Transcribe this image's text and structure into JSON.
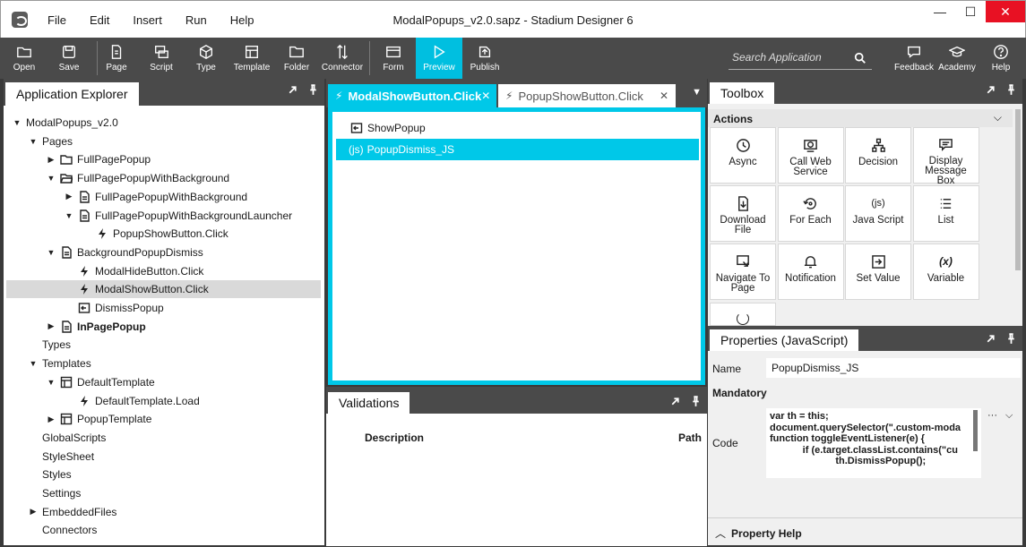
{
  "menu": [
    "File",
    "Edit",
    "Insert",
    "Run",
    "Help"
  ],
  "window_title": "ModalPopups_v2.0.sapz - Stadium Designer 6",
  "window_controls": [
    "—",
    "☐",
    "✕"
  ],
  "toolbar": {
    "items": [
      {
        "label": "Open",
        "icon": "folder-open-icon"
      },
      {
        "label": "Save",
        "icon": "save-icon"
      },
      {
        "label": "Page",
        "icon": "page-icon"
      },
      {
        "label": "Script",
        "icon": "script-icon"
      },
      {
        "label": "Type",
        "icon": "type-icon"
      },
      {
        "label": "Template",
        "icon": "template-icon"
      },
      {
        "label": "Folder",
        "icon": "folder-icon"
      },
      {
        "label": "Connector",
        "icon": "connector-icon"
      },
      {
        "label": "Form",
        "icon": "form-icon"
      },
      {
        "label": "Preview",
        "icon": "preview-icon"
      },
      {
        "label": "Publish",
        "icon": "publish-icon"
      }
    ],
    "search_placeholder": "Search Application",
    "right_items": [
      {
        "label": "Feedback",
        "icon": "feedback-icon"
      },
      {
        "label": "Academy",
        "icon": "academy-icon"
      },
      {
        "label": "Help",
        "icon": "help-icon"
      }
    ]
  },
  "explorer": {
    "title": "Application Explorer",
    "tree": [
      {
        "label": "ModalPopups_v2.0",
        "arrow": "▼",
        "icon": "none",
        "bold": false
      },
      {
        "label": "Pages",
        "arrow": "▼",
        "icon": "none",
        "bold": false
      },
      {
        "label": "FullPagePopup",
        "arrow": "▶",
        "icon": "folder",
        "bold": false
      },
      {
        "label": "FullPagePopupWithBackground",
        "arrow": "▼",
        "icon": "folder-open",
        "bold": false
      },
      {
        "label": "FullPagePopupWithBackground",
        "arrow": "▶",
        "icon": "page",
        "bold": false
      },
      {
        "label": "FullPagePopupWithBackgroundLauncher",
        "arrow": "▼",
        "icon": "page",
        "bold": false
      },
      {
        "label": "PopupShowButton.Click",
        "arrow": "",
        "icon": "bolt",
        "bold": false
      },
      {
        "label": "BackgroundPopupDismiss",
        "arrow": "▼",
        "icon": "page",
        "bold": false
      },
      {
        "label": "ModalHideButton.Click",
        "arrow": "",
        "icon": "bolt",
        "bold": false
      },
      {
        "label": "ModalShowButton.Click",
        "arrow": "",
        "icon": "bolt",
        "bold": false
      },
      {
        "label": "DismissPopup",
        "arrow": "",
        "icon": "script",
        "bold": false
      },
      {
        "label": "InPagePopup",
        "arrow": "▶",
        "icon": "page",
        "bold": true
      },
      {
        "label": "Types",
        "arrow": "",
        "icon": "none",
        "bold": false
      },
      {
        "label": "Templates",
        "arrow": "▼",
        "icon": "none",
        "bold": false
      },
      {
        "label": "DefaultTemplate",
        "arrow": "▼",
        "icon": "template",
        "bold": false
      },
      {
        "label": "DefaultTemplate.Load",
        "arrow": "",
        "icon": "bolt",
        "bold": false
      },
      {
        "label": "PopupTemplate",
        "arrow": "▶",
        "icon": "template",
        "bold": false
      },
      {
        "label": "GlobalScripts",
        "arrow": "",
        "icon": "none",
        "bold": false
      },
      {
        "label": "StyleSheet",
        "arrow": "",
        "icon": "none",
        "bold": false
      },
      {
        "label": "Styles",
        "arrow": "",
        "icon": "none",
        "bold": false
      },
      {
        "label": "Settings",
        "arrow": "",
        "icon": "none",
        "bold": false
      },
      {
        "label": "EmbeddedFiles",
        "arrow": "▶",
        "icon": "none",
        "bold": false
      },
      {
        "label": "Connectors",
        "arrow": "",
        "icon": "none",
        "bold": false
      }
    ]
  },
  "editor": {
    "tabs": [
      {
        "label": "ModalShowButton.Click",
        "close": "✕"
      },
      {
        "label": "PopupShowButton.Click",
        "close": "✕"
      }
    ],
    "lines": [
      {
        "label": "ShowPopup",
        "prefix": ""
      },
      {
        "label": "PopupDismiss_JS",
        "prefix": "(js)"
      }
    ]
  },
  "validations": {
    "title": "Validations",
    "columns": [
      "Description",
      "Path"
    ]
  },
  "toolbox": {
    "title": "Toolbox",
    "section": "Actions",
    "items": [
      {
        "label": "Async",
        "icon": "async-icon"
      },
      {
        "label": "Call Web Service",
        "icon": "web-service-icon"
      },
      {
        "label": "Decision",
        "icon": "decision-icon"
      },
      {
        "label": "Display Message Box",
        "icon": "message-box-icon"
      },
      {
        "label": "Download File",
        "icon": "download-icon"
      },
      {
        "label": "For Each",
        "icon": "for-each-icon"
      },
      {
        "label": "Java Script",
        "icon": "javascript-icon"
      },
      {
        "label": "List",
        "icon": "list-icon"
      },
      {
        "label": "Navigate To Page",
        "icon": "navigate-icon"
      },
      {
        "label": "Notification",
        "icon": "bell-icon"
      },
      {
        "label": "Set Value",
        "icon": "set-value-icon"
      },
      {
        "label": "Variable",
        "icon": "variable-icon"
      }
    ]
  },
  "properties": {
    "title": "Properties (JavaScript)",
    "name_label": "Name",
    "name_value": "PopupDismiss_JS",
    "section": "Mandatory",
    "code_label": "Code",
    "code_lines": [
      "var th = this;",
      "document.querySelector(\".custom-moda",
      "function toggleEventListener(e) {",
      "            if (e.target.classList.contains(\"cu",
      "                        th.DismissPopup();"
    ],
    "more": "···",
    "footer": "Property Help"
  }
}
